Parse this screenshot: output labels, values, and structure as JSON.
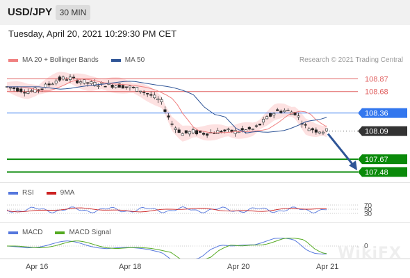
{
  "header": {
    "symbol": "USD/JPY",
    "timeframe": "30 MIN"
  },
  "datetime": "Tuesday, April 20, 2021 10:29:30 PM CET",
  "legend": {
    "items": [
      {
        "label": "MA 20 + Bollinger Bands",
        "color": "#f08080"
      },
      {
        "label": "MA 50",
        "color": "#2f5597"
      }
    ],
    "credit": "Research © 2021 Trading Central"
  },
  "price_levels": [
    {
      "label": "108.87",
      "value": 108.87,
      "style": "resistance",
      "color": "#e06060"
    },
    {
      "label": "108.68",
      "value": 108.68,
      "style": "resistance",
      "color": "#e06060"
    },
    {
      "label": "108.36",
      "value": 108.36,
      "style": "pivot",
      "color": "#3377ee"
    },
    {
      "label": "108.09",
      "value": 108.09,
      "style": "last",
      "color": "#333333"
    },
    {
      "label": "107.67",
      "value": 107.67,
      "style": "target",
      "color": "#0a8a0a"
    },
    {
      "label": "107.48",
      "value": 107.48,
      "style": "target",
      "color": "#0a8a0a"
    }
  ],
  "rsi_legend": [
    {
      "label": "RSI",
      "color": "#5577dd"
    },
    {
      "label": "9MA",
      "color": "#cc2222"
    }
  ],
  "rsi_levels": [
    "70",
    "50",
    "30"
  ],
  "macd_legend": [
    {
      "label": "MACD",
      "color": "#5577dd"
    },
    {
      "label": "MACD Signal",
      "color": "#55aa22"
    }
  ],
  "macd_zero": "0",
  "x_labels": [
    "Apr 16",
    "Apr 18",
    "Apr 20",
    "Apr 21"
  ],
  "watermark": "WikiFX",
  "chart_data": {
    "type": "candlestick",
    "title": "USD/JPY",
    "timeframe": "30 MIN",
    "ylim": [
      107.35,
      109.05
    ],
    "x_ticks": [
      "Apr 16",
      "Apr 18",
      "Apr 20",
      "Apr 21"
    ],
    "close_path": [
      108.75,
      108.72,
      108.68,
      108.7,
      108.78,
      108.86,
      108.88,
      108.84,
      108.8,
      108.79,
      108.78,
      108.77,
      108.74,
      108.7,
      108.62,
      108.52,
      108.2,
      108.05,
      108.08,
      108.06,
      108.07,
      108.09,
      108.08,
      108.1,
      108.12,
      108.25,
      108.38,
      108.4,
      108.36,
      108.15,
      108.1,
      108.09
    ],
    "support": [
      107.67,
      107.48
    ],
    "resistance": [
      108.68,
      108.87
    ],
    "pivot": 108.36,
    "last": 108.09
  }
}
